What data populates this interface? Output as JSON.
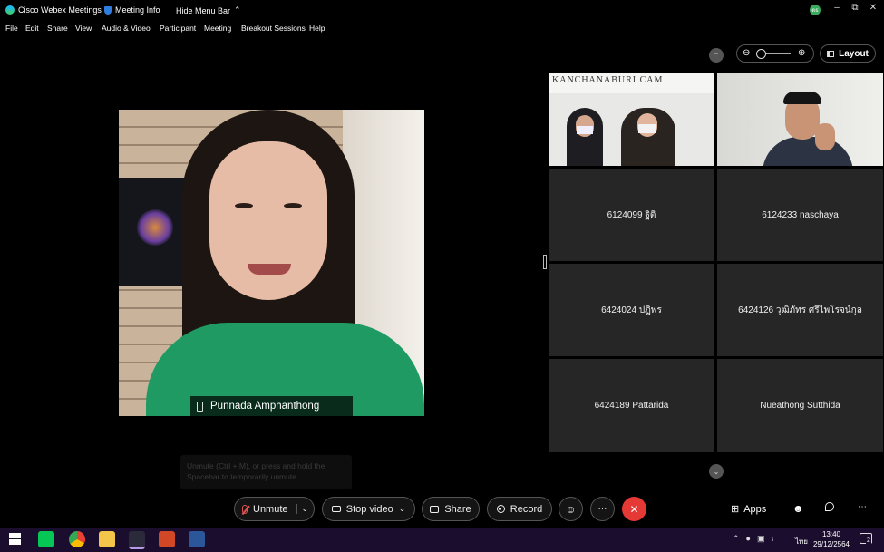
{
  "titlebar": {
    "app_title": "Cisco Webex Meetings",
    "meeting_info": "Meeting Info",
    "hide_menu": "Hide Menu Bar",
    "avatar_initials": "ดธ"
  },
  "menu": [
    "File",
    "Edit",
    "Share",
    "View",
    "Audio & Video",
    "Participant",
    "Meeting",
    "Breakout Sessions",
    "Help"
  ],
  "layout_button": "Layout",
  "main_video": {
    "name": "Punnada Amphanthong",
    "hint": "Unmute (Ctrl + M), or press and hold the Spacebar to temporarily unmute",
    "backdrop_text": "KANCHANABURI CAM"
  },
  "tiles": [
    {
      "name": "6124099 ฐิติ"
    },
    {
      "name": "6124233 naschaya"
    },
    {
      "name": "6424024 ปฏิพร"
    },
    {
      "name": "6424126 วุฒิภัทร ศรีไพโรจน์กุล"
    },
    {
      "name": "6424189 Pattarida"
    },
    {
      "name": "Nueathong Sutthida"
    }
  ],
  "controls": {
    "unmute": "Unmute",
    "stop_video": "Stop video",
    "share": "Share",
    "record": "Record",
    "more": "···",
    "apps": "Apps"
  },
  "taskbar": {
    "time": "13:40",
    "date": "29/12/2564",
    "language": "ไทย",
    "notification_count": "2"
  },
  "colors": {
    "end_call": "#e53935",
    "taskbar": "#1a0d2e",
    "tile_bg": "#262626"
  }
}
